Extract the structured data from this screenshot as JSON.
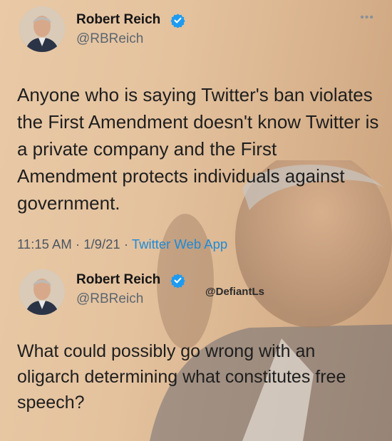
{
  "tweets": [
    {
      "display_name": "Robert Reich",
      "handle": "@RBReich",
      "text": "Anyone who is saying Twitter's ban violates the First Amendment doesn't know Twitter is a private company and the First Amendment protects individuals against government.",
      "time": "11:15 AM",
      "separator": "·",
      "date": "1/9/21",
      "source": "Twitter Web App",
      "more_icon": "•••"
    },
    {
      "display_name": "Robert Reich",
      "handle": "@RBReich",
      "text": "What could possibly go wrong with an oligarch determining what constitutes free speech?"
    }
  ],
  "watermark": "@DefiantLs",
  "colors": {
    "verified": "#1d9bf0",
    "link": "#1d8ad6",
    "background": "#e4c29e"
  },
  "icons": {
    "verified": "verified-badge-icon",
    "more": "more-horizontal-icon"
  }
}
